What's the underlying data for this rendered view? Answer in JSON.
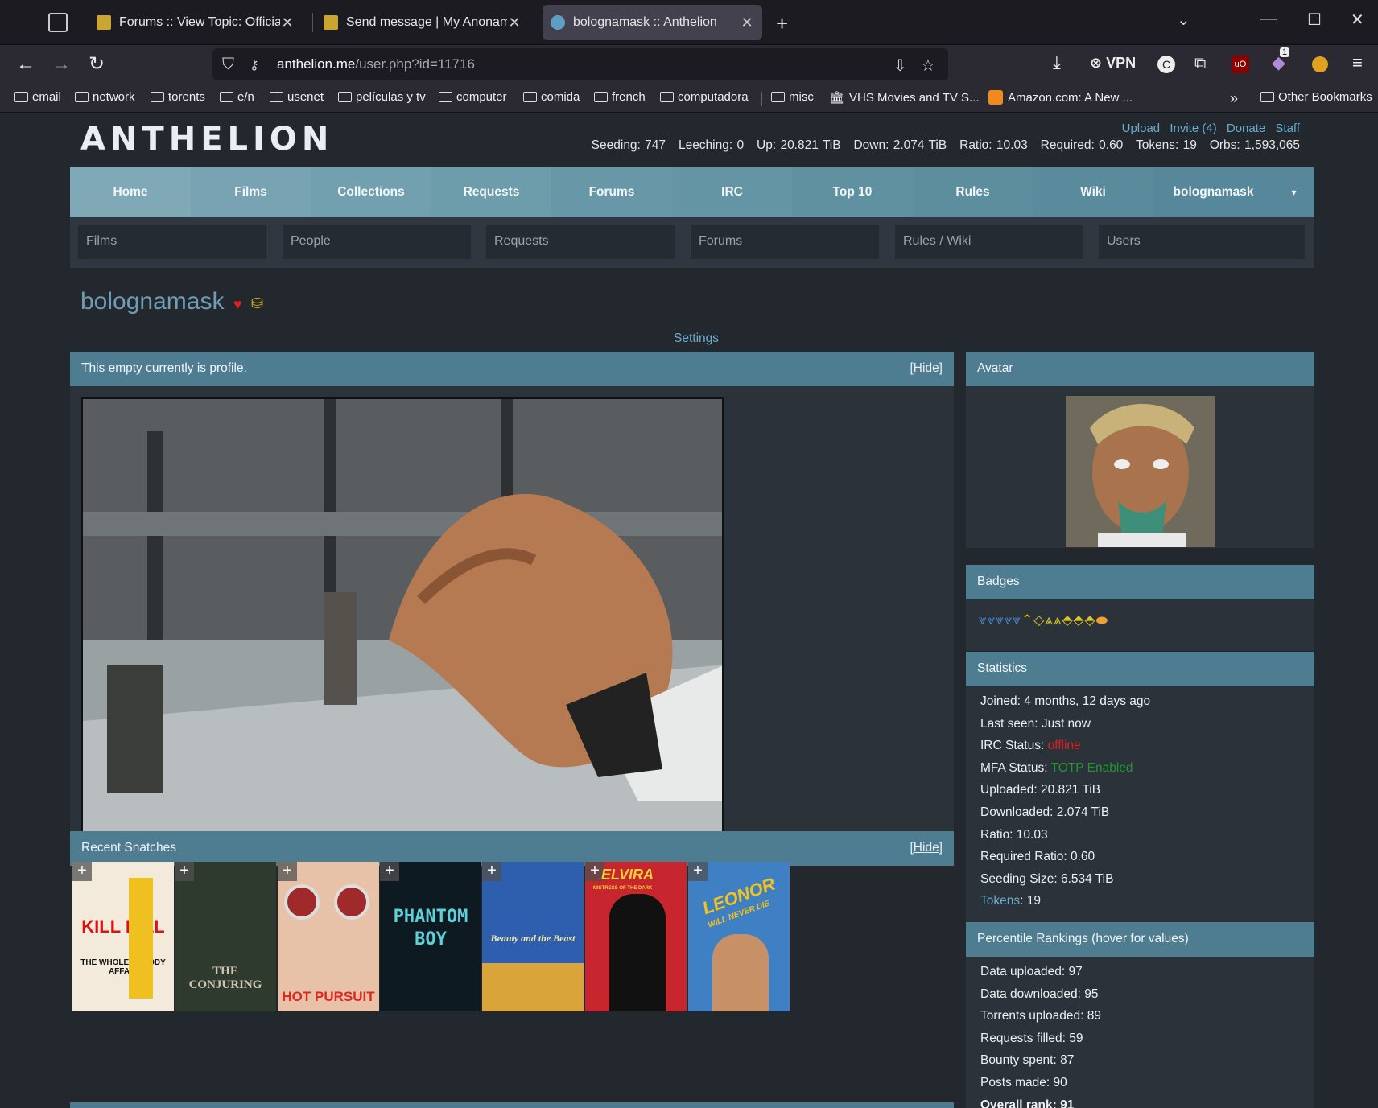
{
  "browser": {
    "tabs": [
      {
        "label": "Forums :: View Topic: Official Intr",
        "active": false
      },
      {
        "label": "Send message | My Anonamouse",
        "active": false
      },
      {
        "label": "bolognamask :: Anthelion",
        "active": true
      }
    ],
    "url_domain": "anthelion.me",
    "url_path": "/user.php?id=11716",
    "vpn_label": "VPN",
    "ext_badge": "1",
    "bookmarks": [
      "email",
      "network",
      "torents",
      "e/n",
      "usenet",
      "películas y tv",
      "computer",
      "comida",
      "french",
      "computadora",
      "misc",
      "VHS Movies and TV S...",
      "Amazon.com: A New ..."
    ],
    "other_bookmarks": "Other Bookmarks"
  },
  "site": {
    "logo": "ANTHELION",
    "top_links": [
      "Upload",
      "Invite (4)",
      "Donate",
      "Staff"
    ],
    "stats_line": "Seeding: 747   Leeching: 0   Up: 20.821 TiB   Down: 2.074 TiB   Ratio: 10.03   Required: 0.60   Tokens: 19   Orbs: 1,593,065",
    "menu": [
      "Home",
      "Films",
      "Collections",
      "Requests",
      "Forums",
      "IRC",
      "Top 10",
      "Rules",
      "Wiki",
      "bolognamask"
    ],
    "menu_caret": "▾",
    "search_placeholders": [
      "Films",
      "People",
      "Requests",
      "Forums",
      "Rules / Wiki",
      "Users"
    ]
  },
  "profile": {
    "username": "bolognamask",
    "settings_link": "Settings",
    "profile_text": "This empty currently is profile.",
    "hide_label": "[Hide]",
    "recent_snatches_title": "Recent Snatches",
    "snatches": [
      {
        "title": "KILL BILL",
        "subtitle": "THE WHOLE BLOODY AFFAIR"
      },
      {
        "title": "THE CONJURING",
        "subtitle": ""
      },
      {
        "title": "HOT PURSUIT",
        "subtitle": ""
      },
      {
        "title": "PHANTOM BOY",
        "subtitle": ""
      },
      {
        "title": "Beauty and the Beast",
        "subtitle": ""
      },
      {
        "title": "ELVIRA",
        "subtitle": "MISTRESS OF THE DARK"
      },
      {
        "title": "LEONOR",
        "subtitle": "WILL NEVER DIE"
      }
    ]
  },
  "sidebar": {
    "avatar_title": "Avatar",
    "badges_title": "Badges",
    "statistics_title": "Statistics",
    "statistics": {
      "joined": "Joined: 4 months, 12 days ago",
      "last_seen": "Last seen: Just now",
      "irc_label": "IRC Status: ",
      "irc_value": "offline",
      "mfa_label": "MFA Status: ",
      "mfa_value": "TOTP Enabled",
      "uploaded": "Uploaded: 20.821 TiB",
      "downloaded": "Downloaded: 2.074 TiB",
      "ratio": "Ratio: 10.03",
      "required_ratio": "Required Ratio: 0.60",
      "seeding_size": "Seeding Size: 6.534 TiB",
      "tokens_label": "Tokens",
      "tokens_value": ": 19"
    },
    "percentile_title": "Percentile Rankings (hover for values)",
    "percentiles": [
      "Data uploaded: 97",
      "Data downloaded: 95",
      "Torrents uploaded: 89",
      "Requests filled: 59",
      "Bounty spent: 87",
      "Posts made: 90",
      "Overall rank: 91"
    ]
  },
  "colors": {
    "accent_header": "#4e7c90",
    "link": "#6aaccc",
    "offline": "#e21f1f",
    "enabled": "#1f9a2a",
    "menu_light": "#7fa9b7",
    "menu_dark": "#5a8b9c"
  }
}
